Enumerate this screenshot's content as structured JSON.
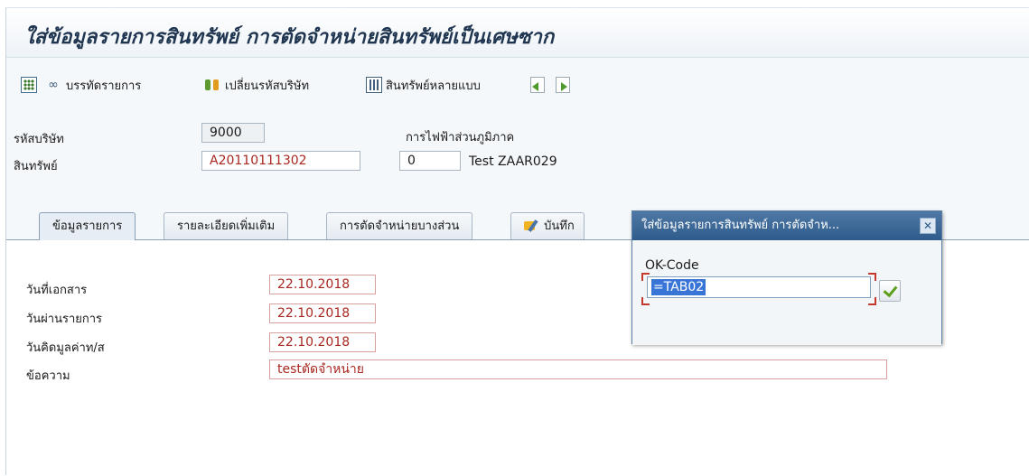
{
  "window": {
    "title": "ใส่ข้อมูลรายการสินทรัพย์ การตัดจำหน่ายสินทรัพย์เป็นเศษซาก"
  },
  "toolbar": {
    "items": [
      {
        "label": "",
        "icon": "select-grid-icon"
      },
      {
        "label": "บรรทัดรายการ",
        "icon": "glasses-icon"
      },
      {
        "label": "เปลี่ยนรหัสบริษัท",
        "icon": "switch-company-icon"
      },
      {
        "label": "สินทรัพย์หลายแบบ",
        "icon": "multiple-assets-icon"
      },
      {
        "label": "",
        "icon": "previous-icon"
      },
      {
        "label": "",
        "icon": "next-icon"
      }
    ]
  },
  "header": {
    "company_code_label": "รหัสบริษัท",
    "company_code": "9000",
    "company_name": "การไฟฟ้าส่วนภูมิภาค",
    "asset_label": "สินทรัพย์",
    "asset_number": "A20110111302",
    "sub_number": "0",
    "asset_description": "Test ZAAR029"
  },
  "tabs": [
    {
      "label": "ข้อมูลรายการ",
      "active": true
    },
    {
      "label": "รายละเอียดเพิ่มเติม",
      "active": false
    },
    {
      "label": "การตัดจำหน่ายบางส่วน",
      "active": false
    },
    {
      "label": "บันทึก",
      "active": false,
      "icon": "note-icon"
    }
  ],
  "form": {
    "document_date_label": "วันที่เอกสาร",
    "document_date": "22.10.2018",
    "posting_date_label": "วันผ่านรายการ",
    "posting_date": "22.10.2018",
    "value_date_label": "วันคิดมูลค่าท/ส",
    "value_date": "22.10.2018",
    "text_label": "ข้อความ",
    "text_value": "testตัดจำหน่าย"
  },
  "dialog": {
    "title": "ใส่ข้อมูลรายการสินทรัพย์ การตัดจำห...",
    "close_glyph": "✕",
    "ok_code_label": "OK-Code",
    "ok_code_value": "=TAB02"
  },
  "colors": {
    "title_text": "#1f3550",
    "dialog_header": "#3f6b98",
    "required_text": "#a8271f",
    "selection": "#3875d7"
  }
}
